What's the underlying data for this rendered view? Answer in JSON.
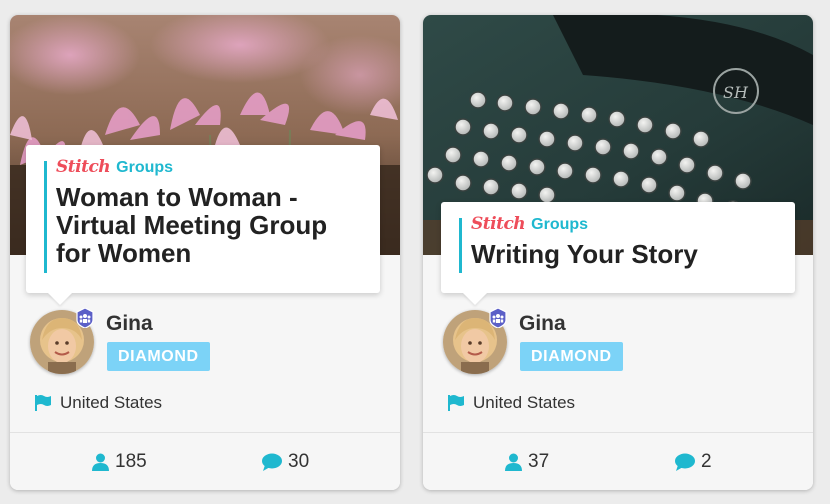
{
  "colors": {
    "accent_teal": "#1fb8cf",
    "brand_red": "#ee4d5a",
    "tier_badge": "#7cd3f7"
  },
  "cards": [
    {
      "brand_logo": "Stitch",
      "brand_tag": "Groups",
      "title": "Woman to Woman - Virtual Meeting Group for Women",
      "cover_icon": "pink-flowers-photo",
      "host": {
        "name": "Gina",
        "tier": "DIAMOND",
        "badge_icon": "host-badge-icon"
      },
      "location": "United States",
      "members": "185",
      "comments": "30"
    },
    {
      "brand_logo": "Stitch",
      "brand_tag": "Groups",
      "title": "Writing Your Story",
      "cover_icon": "typewriter-photo",
      "host": {
        "name": "Gina",
        "tier": "DIAMOND",
        "badge_icon": "host-badge-icon"
      },
      "location": "United States",
      "members": "37",
      "comments": "2"
    }
  ]
}
